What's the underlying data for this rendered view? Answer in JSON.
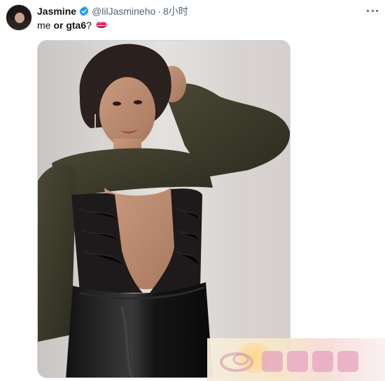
{
  "tweet": {
    "display_name": "Jasmine",
    "handle": "@lilJasmineho",
    "separator": "·",
    "time": "8小时",
    "text_plain": "me",
    "text_bold": "or gta6",
    "text_tail": "?",
    "verified": true
  },
  "icons": {
    "verified": "verified-badge-icon",
    "more": "more-horizontal-icon",
    "emoji": "lips-kiss-emoji-icon"
  },
  "colors": {
    "text_primary": "#0f1419",
    "text_secondary": "#536471",
    "verified_blue": "#1d9bf0",
    "emoji_red": "#e0245e"
  }
}
